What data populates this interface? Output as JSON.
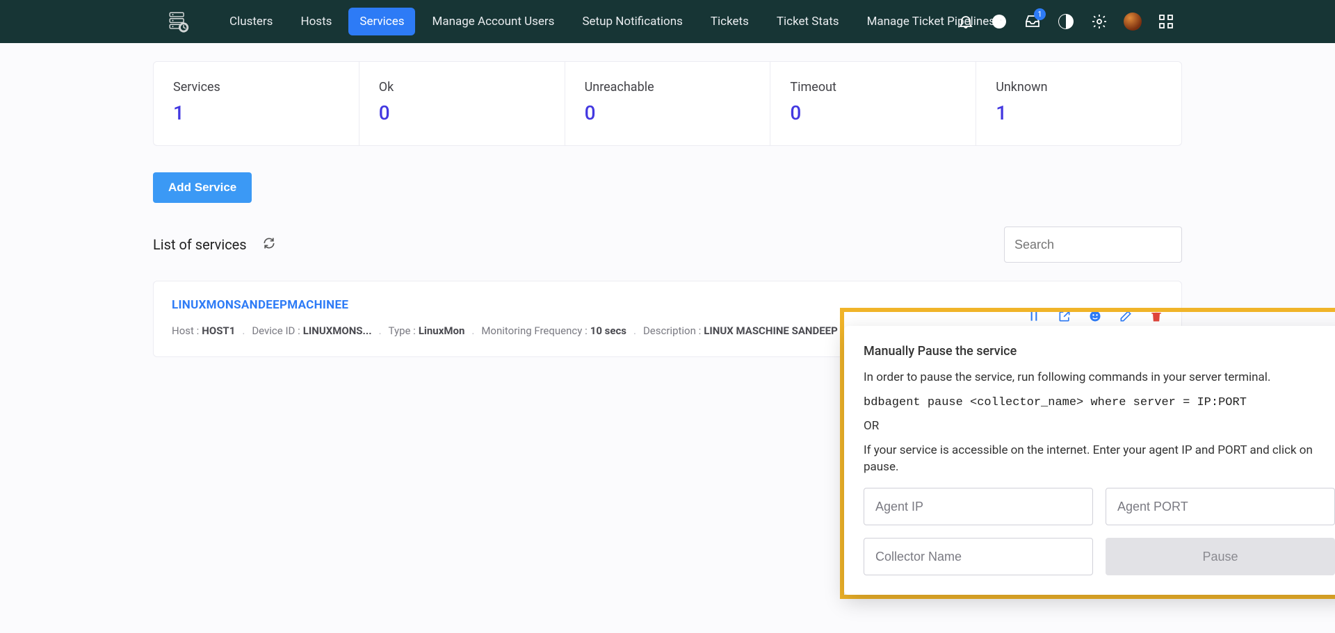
{
  "nav": {
    "items": [
      {
        "label": "Clusters",
        "active": false
      },
      {
        "label": "Hosts",
        "active": false
      },
      {
        "label": "Services",
        "active": true
      },
      {
        "label": "Manage Account Users",
        "active": false
      },
      {
        "label": "Setup Notifications",
        "active": false
      },
      {
        "label": "Tickets",
        "active": false
      },
      {
        "label": "Ticket Stats",
        "active": false
      },
      {
        "label": "Manage Ticket Pipelines",
        "active": false
      }
    ],
    "inbox_badge": "1"
  },
  "stats": [
    {
      "label": "Services",
      "value": "1"
    },
    {
      "label": "Ok",
      "value": "0"
    },
    {
      "label": "Unreachable",
      "value": "0"
    },
    {
      "label": "Timeout",
      "value": "0"
    },
    {
      "label": "Unknown",
      "value": "1"
    }
  ],
  "buttons": {
    "add_service": "Add Service",
    "pause": "Pause"
  },
  "list": {
    "title": "List of services",
    "search_placeholder": "Search"
  },
  "service": {
    "name": "LINUXMONSANDEEPMACHINEE",
    "host_label": "Host :",
    "host_value": "HOST1",
    "device_label": "Device ID :",
    "device_value": "LINUXMONS...",
    "type_label": "Type :",
    "type_value": "LinuxMon",
    "freq_label": "Monitoring Frequency :",
    "freq_value": "10 secs",
    "desc_label": "Description :",
    "desc_value": "LINUX MASCHINE SANDEEP"
  },
  "popover": {
    "title": "Manually Pause the service",
    "line1": "In order to pause the service, run following commands in your server terminal.",
    "cmd": "bdbagent pause <collector_name> where server = IP:PORT",
    "or": "OR",
    "line2": "If your service is accessible on the internet. Enter your agent IP and PORT and click on pause.",
    "ph_ip": "Agent IP",
    "ph_port": "Agent PORT",
    "ph_collector": "Collector Name"
  }
}
